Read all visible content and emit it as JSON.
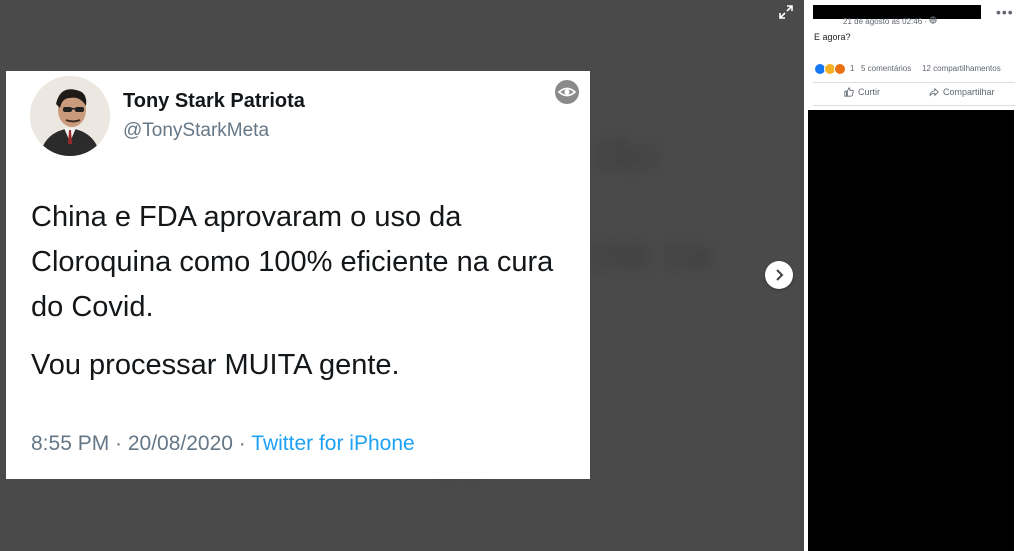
{
  "viewer": {
    "background": "#4a4a4a",
    "expand_icon": "expand-icon",
    "next_icon": "chevron-right-icon"
  },
  "tweet": {
    "name": "Tony Stark Patriota",
    "handle": "@TonyStarkMeta",
    "body_line1": "China e FDA aprovaram o uso da Cloroquina como 100% eficiente na cura do Covid.",
    "body_line2": "Vou processar MUITA gente.",
    "time_date": "8:55 PM · 20/08/2020 ·",
    "source": "Twitter for iPhone",
    "source_color": "#1da1f2"
  },
  "post": {
    "date": "21 de agosto às 02:46 · ",
    "text": "E agora?",
    "reaction_count": "1",
    "comments": "5 comentários",
    "shares": "12 compartilhamentos",
    "like_label": "Curtir",
    "share_label": "Compartilhar"
  }
}
